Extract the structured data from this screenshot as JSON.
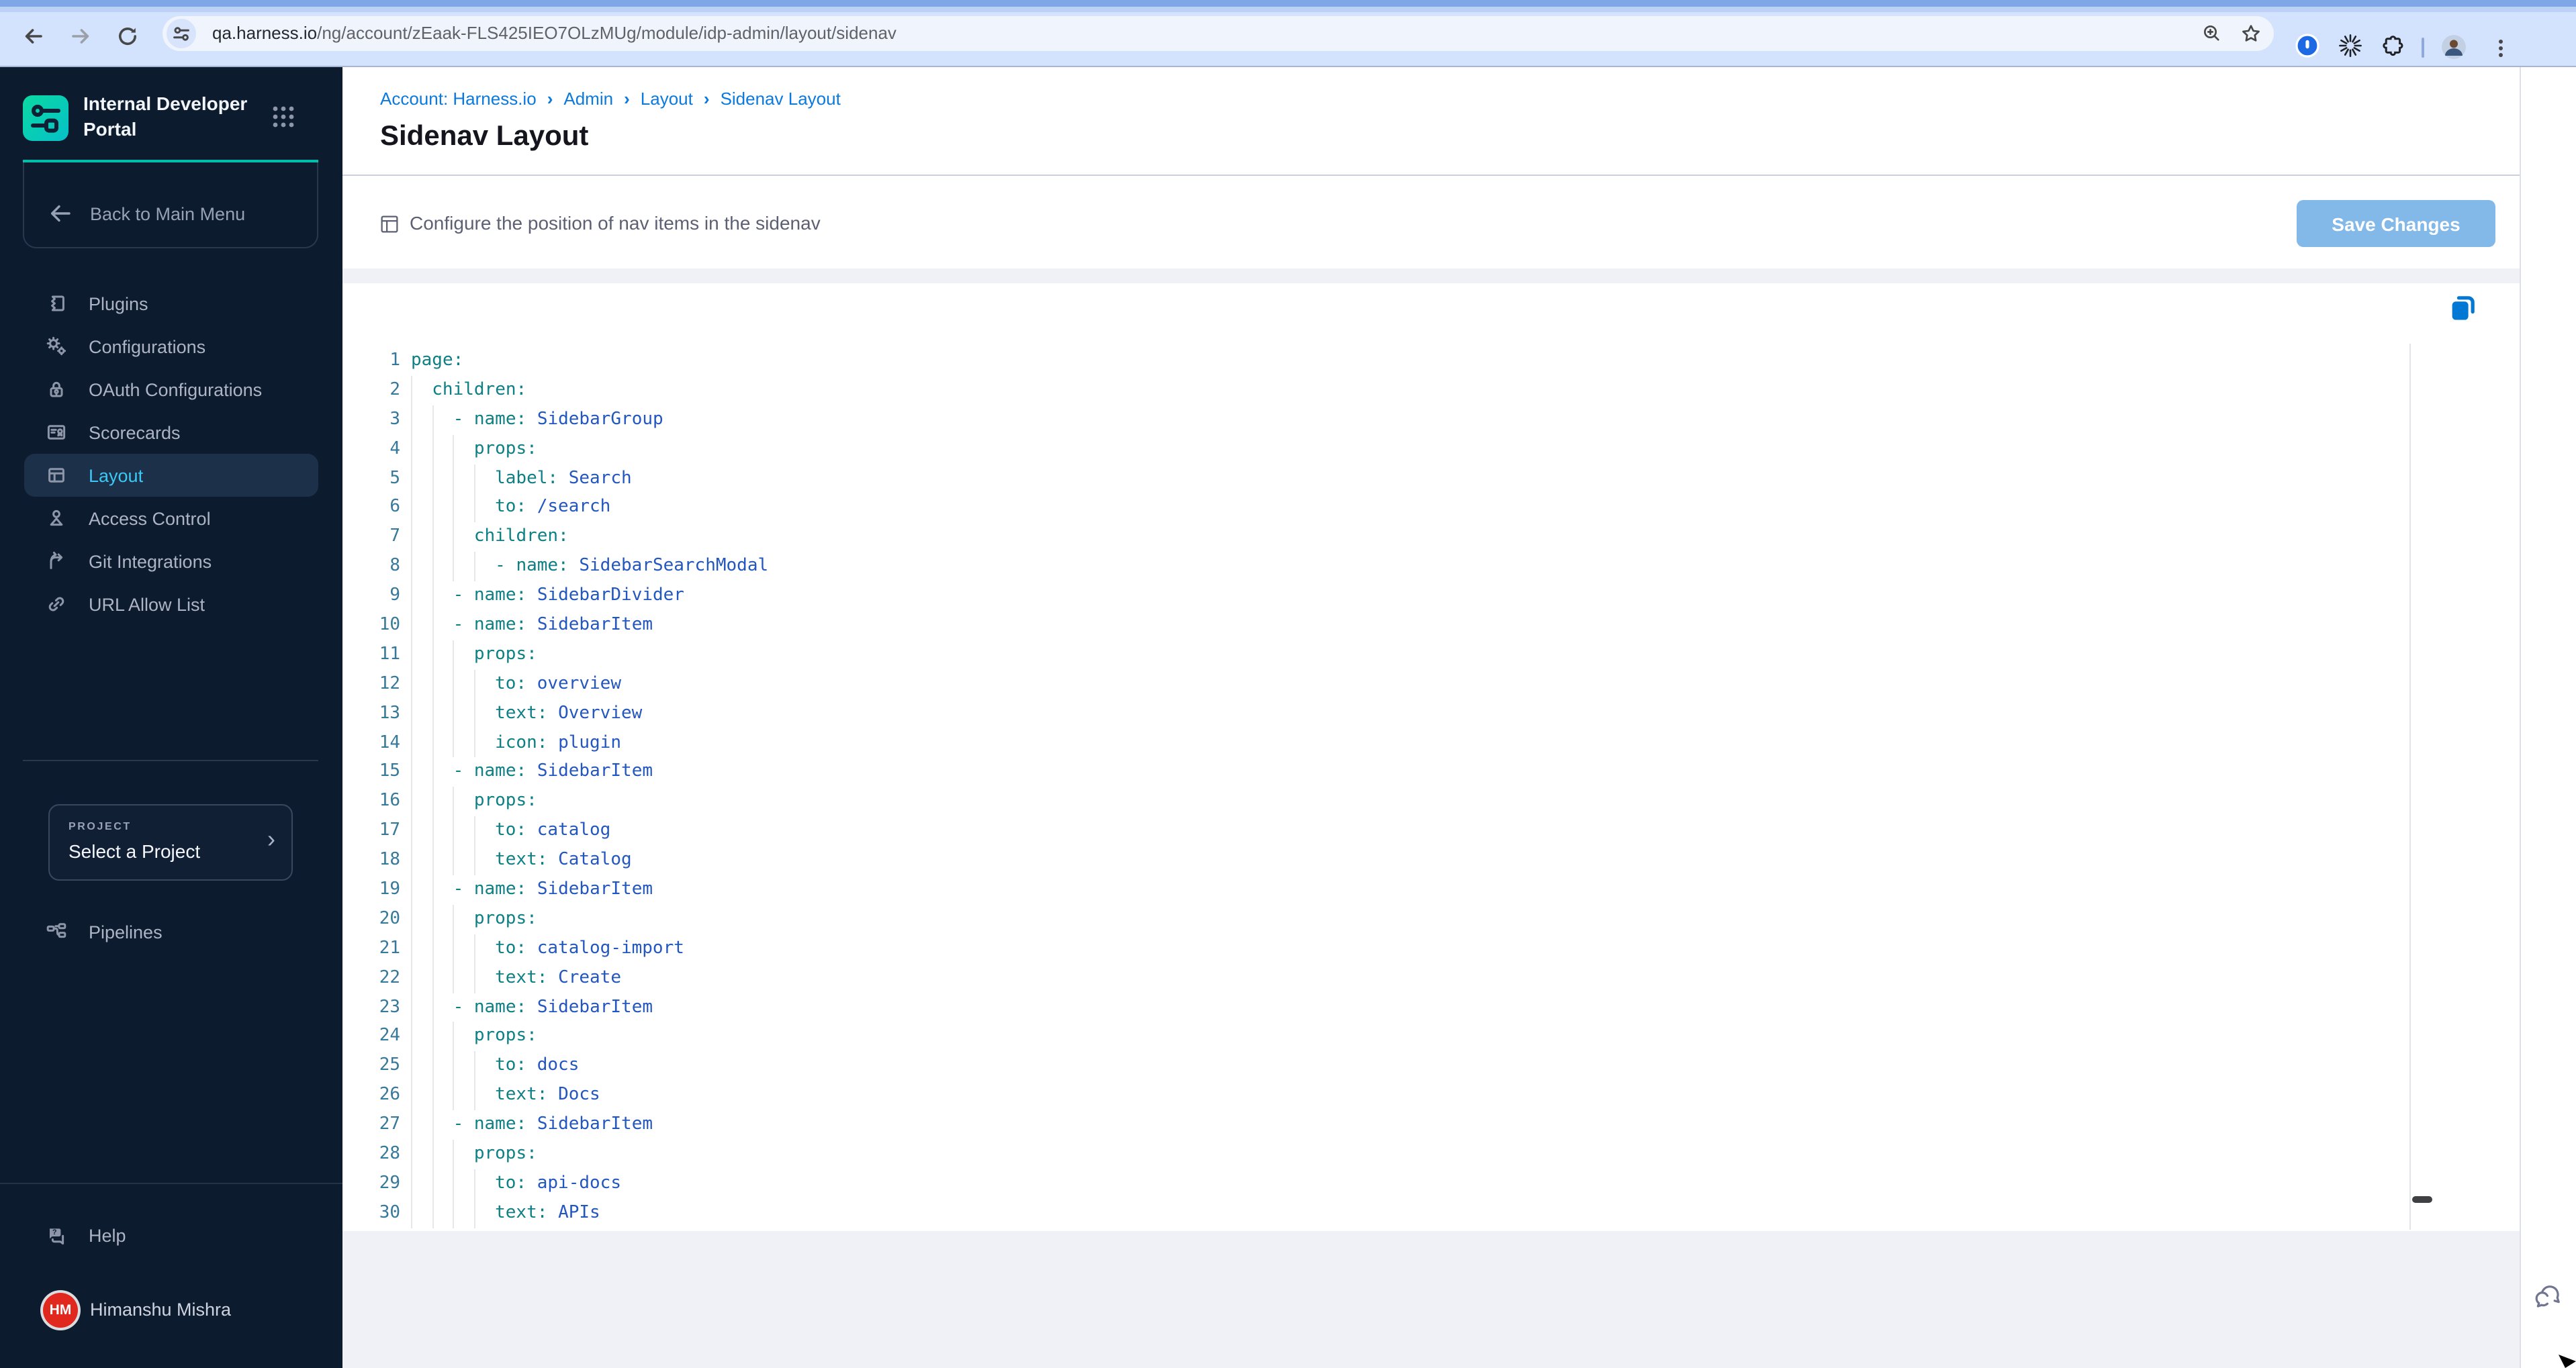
{
  "browser": {
    "url": {
      "domain": "qa.harness.io",
      "path": "/ng/account/zEaak-FLS425IEO7OLzMUg/module/idp-admin/layout/sidenav"
    },
    "nav_icons": [
      "back-arrow-icon",
      "forward-arrow-icon",
      "reload-icon"
    ],
    "pill_icons": [
      "tune-icon",
      "zoom-icon",
      "bookmark-star-icon"
    ],
    "extension_icons": [
      "onepassword-icon",
      "spinner-extension-icon",
      "extensions-puzzle-icon"
    ],
    "right_icons": [
      "profile-avatar",
      "kebab-menu-icon"
    ]
  },
  "sidebar": {
    "product_name": "Internal Developer Portal",
    "back_label": "Back to Main Menu",
    "items": [
      {
        "label": "Plugins",
        "icon": "plugin-icon",
        "active": false
      },
      {
        "label": "Configurations",
        "icon": "gears-icon",
        "active": false
      },
      {
        "label": "OAuth Configurations",
        "icon": "lock-icon",
        "active": false
      },
      {
        "label": "Scorecards",
        "icon": "scorecard-icon",
        "active": false
      },
      {
        "label": "Layout",
        "icon": "layout-icon",
        "active": true
      },
      {
        "label": "Access Control",
        "icon": "person-icon",
        "active": false
      },
      {
        "label": "Git Integrations",
        "icon": "branch-icon",
        "active": false
      },
      {
        "label": "URL Allow List",
        "icon": "link-icon",
        "active": false
      }
    ],
    "project": {
      "label": "PROJECT",
      "value": "Select a Project"
    },
    "pipelines_label": "Pipelines",
    "help_label": "Help",
    "user": {
      "initials": "HM",
      "name": "Himanshu Mishra",
      "avatar_color": "#e0281e"
    }
  },
  "main": {
    "breadcrumbs": [
      "Account: Harness.io",
      "Admin",
      "Layout",
      "Sidenav Layout"
    ],
    "title": "Sidenav Layout",
    "description": "Configure the position of nav items in the sidenav",
    "save_label": "Save Changes"
  },
  "editor": {
    "language": "yaml",
    "colors": {
      "key": "#0d7f85",
      "value": "#2357c0",
      "line_number": "#37799a",
      "indent_guide": "#e6e7eb",
      "active_nav": "#3cc8f5",
      "breadcrumb": "#0b79dd",
      "save_button_bg": "#83b9e9",
      "sidebar_bg": "#0c1b2e",
      "teal_accent": "#01bdaa"
    },
    "lines": [
      {
        "n": 1,
        "indent": 0,
        "dash": false,
        "key": "page:",
        "value": ""
      },
      {
        "n": 2,
        "indent": 1,
        "dash": false,
        "key": "children:",
        "value": ""
      },
      {
        "n": 3,
        "indent": 2,
        "dash": true,
        "key": "name:",
        "value": "SidebarGroup"
      },
      {
        "n": 4,
        "indent": 3,
        "dash": false,
        "key": "props:",
        "value": ""
      },
      {
        "n": 5,
        "indent": 4,
        "dash": false,
        "key": "label:",
        "value": "Search"
      },
      {
        "n": 6,
        "indent": 4,
        "dash": false,
        "key": "to:",
        "value": "/search"
      },
      {
        "n": 7,
        "indent": 3,
        "dash": false,
        "key": "children:",
        "value": ""
      },
      {
        "n": 8,
        "indent": 4,
        "dash": true,
        "key": "name:",
        "value": "SidebarSearchModal"
      },
      {
        "n": 9,
        "indent": 2,
        "dash": true,
        "key": "name:",
        "value": "SidebarDivider"
      },
      {
        "n": 10,
        "indent": 2,
        "dash": true,
        "key": "name:",
        "value": "SidebarItem"
      },
      {
        "n": 11,
        "indent": 3,
        "dash": false,
        "key": "props:",
        "value": ""
      },
      {
        "n": 12,
        "indent": 4,
        "dash": false,
        "key": "to:",
        "value": "overview"
      },
      {
        "n": 13,
        "indent": 4,
        "dash": false,
        "key": "text:",
        "value": "Overview"
      },
      {
        "n": 14,
        "indent": 4,
        "dash": false,
        "key": "icon:",
        "value": "plugin"
      },
      {
        "n": 15,
        "indent": 2,
        "dash": true,
        "key": "name:",
        "value": "SidebarItem"
      },
      {
        "n": 16,
        "indent": 3,
        "dash": false,
        "key": "props:",
        "value": ""
      },
      {
        "n": 17,
        "indent": 4,
        "dash": false,
        "key": "to:",
        "value": "catalog"
      },
      {
        "n": 18,
        "indent": 4,
        "dash": false,
        "key": "text:",
        "value": "Catalog"
      },
      {
        "n": 19,
        "indent": 2,
        "dash": true,
        "key": "name:",
        "value": "SidebarItem"
      },
      {
        "n": 20,
        "indent": 3,
        "dash": false,
        "key": "props:",
        "value": ""
      },
      {
        "n": 21,
        "indent": 4,
        "dash": false,
        "key": "to:",
        "value": "catalog-import"
      },
      {
        "n": 22,
        "indent": 4,
        "dash": false,
        "key": "text:",
        "value": "Create"
      },
      {
        "n": 23,
        "indent": 2,
        "dash": true,
        "key": "name:",
        "value": "SidebarItem"
      },
      {
        "n": 24,
        "indent": 3,
        "dash": false,
        "key": "props:",
        "value": ""
      },
      {
        "n": 25,
        "indent": 4,
        "dash": false,
        "key": "to:",
        "value": "docs"
      },
      {
        "n": 26,
        "indent": 4,
        "dash": false,
        "key": "text:",
        "value": "Docs"
      },
      {
        "n": 27,
        "indent": 2,
        "dash": true,
        "key": "name:",
        "value": "SidebarItem"
      },
      {
        "n": 28,
        "indent": 3,
        "dash": false,
        "key": "props:",
        "value": ""
      },
      {
        "n": 29,
        "indent": 4,
        "dash": false,
        "key": "to:",
        "value": "api-docs"
      },
      {
        "n": 30,
        "indent": 4,
        "dash": false,
        "key": "text:",
        "value": "APIs"
      }
    ]
  }
}
